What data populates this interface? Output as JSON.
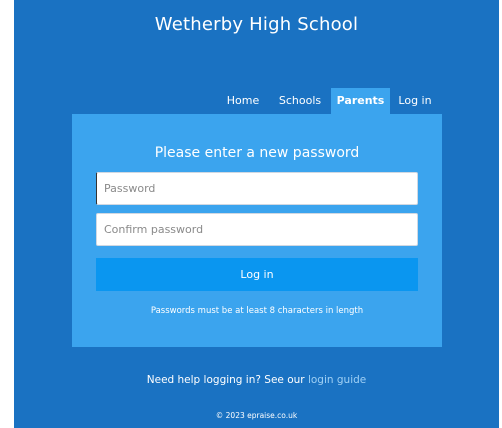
{
  "header": {
    "title": "Wetherby High School"
  },
  "nav": {
    "items": [
      {
        "label": "Home"
      },
      {
        "label": "Schools"
      },
      {
        "label": "Parents"
      },
      {
        "label": "Log in"
      }
    ],
    "active": "Parents"
  },
  "form": {
    "title": "Please enter a new password",
    "password_placeholder": "Password",
    "password_value": "",
    "confirm_placeholder": "Confirm password",
    "confirm_value": "",
    "submit_label": "Log in",
    "hint": "Passwords must be at least 8 characters in length"
  },
  "footer": {
    "help_prefix": "Need help logging in? See our",
    "help_link": "login guide",
    "copyright": "© 2023 epraise.co.uk"
  },
  "colors": {
    "background": "#1a72c2",
    "panel": "#3ba4ee",
    "button": "#0a96f0",
    "link": "#9fd0f5"
  }
}
